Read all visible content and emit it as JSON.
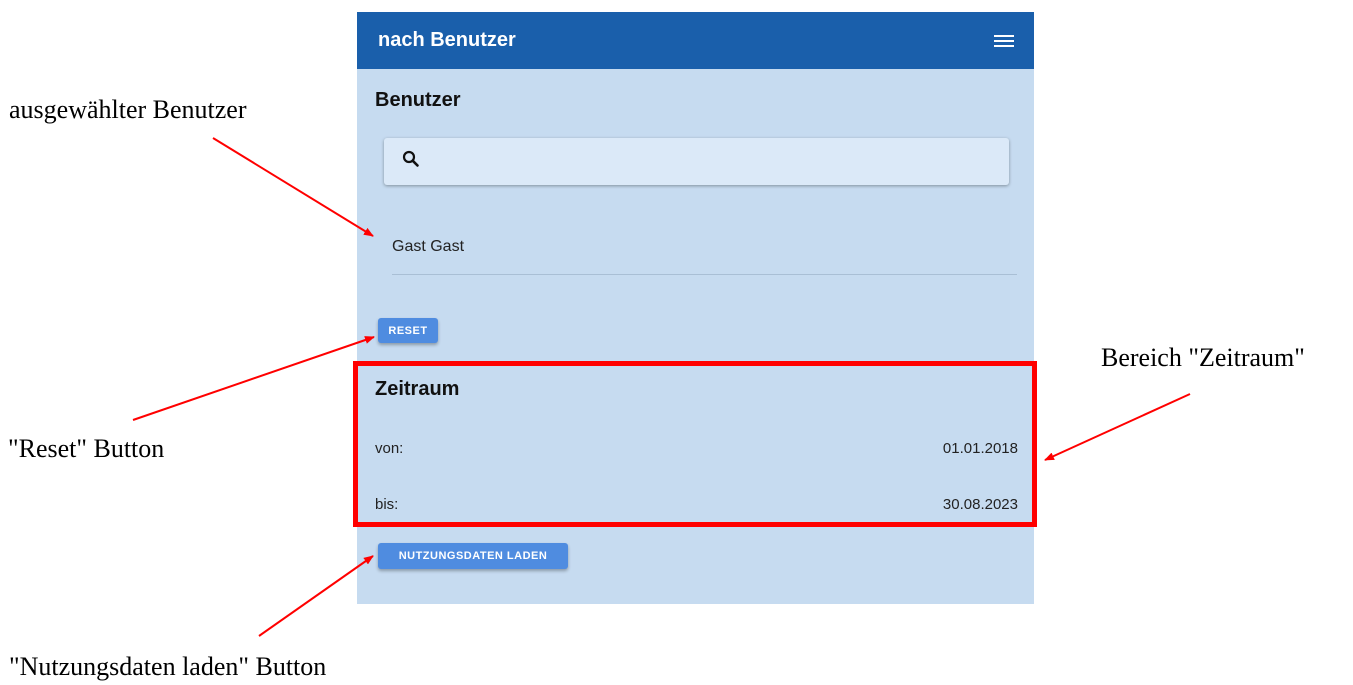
{
  "app_bar": {
    "title": "nach Benutzer",
    "menu_icon": "hamburger-menu-icon"
  },
  "user_section": {
    "title": "Benutzer",
    "search_icon": "search-icon",
    "search_value": "",
    "selected_user": "Gast Gast",
    "reset_label": "RESET"
  },
  "period_section": {
    "title": "Zeitraum",
    "from_label": "von:",
    "from_value": "01.01.2018",
    "to_label": "bis:",
    "to_value": "30.08.2023"
  },
  "load_button_label": "NUTZUNGSDATEN LADEN",
  "annotations": {
    "selected_user": "ausgewählter Benutzer",
    "reset_button": "\"Reset\" Button",
    "period_area": "Bereich \"Zeitraum\"",
    "load_button": "\"Nutzungsdaten laden\" Button"
  },
  "colors": {
    "app_bar": "#1a5fab",
    "background": "#c6dbf0",
    "button": "#4f8ce0",
    "annotation": "#ff0000"
  }
}
